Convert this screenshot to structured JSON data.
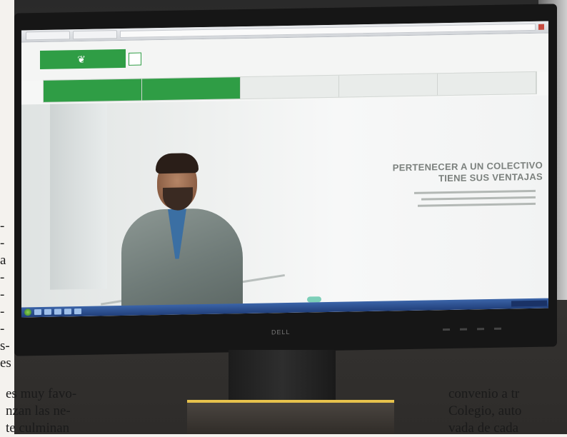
{
  "newspaper": {
    "left_col": [
      "-",
      "-",
      "a",
      "-",
      "-",
      "-",
      "-",
      "s-",
      "es"
    ],
    "left_bottom": [
      "es muy favo-",
      "nzan las ne-",
      "te culminan"
    ],
    "right_bottom": [
      "convenio a tr",
      "Colegio, auto",
      "vada de cada"
    ]
  },
  "website": {
    "logo_text": "",
    "tagline": "",
    "header_link": "",
    "nav": [
      "",
      "",
      "",
      "",
      ""
    ],
    "hero_title": [
      "PERTENECER A UN COLECTIVO",
      "TIENE SUS VENTAJAS"
    ],
    "hero_link": "",
    "colors": {
      "brand_green": "#2f9d45",
      "taskbar_blue": "#2b4f92"
    }
  },
  "monitor": {
    "brand": "DELL"
  }
}
